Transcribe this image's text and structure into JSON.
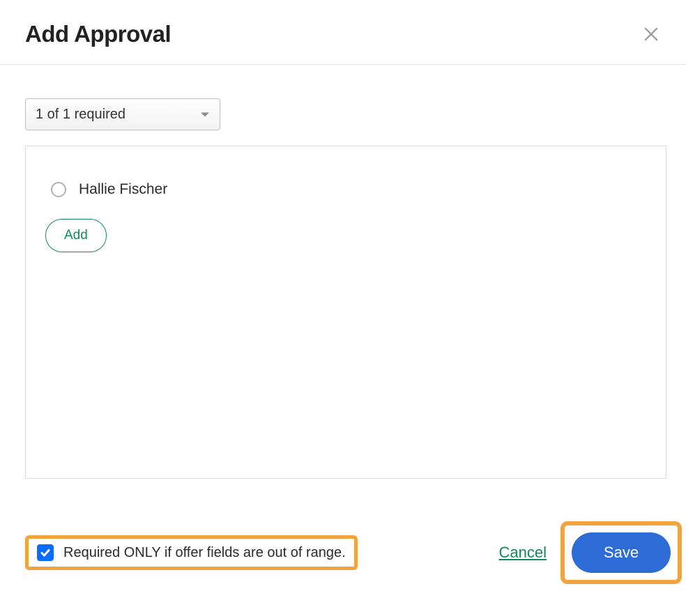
{
  "modal": {
    "title": "Add Approval"
  },
  "select": {
    "value": "1 of 1 required"
  },
  "panel": {
    "person_name": "Hallie Fischer",
    "add_label": "Add"
  },
  "footer": {
    "checkbox_label": "Required ONLY if offer fields are out of range.",
    "cancel_label": "Cancel",
    "save_label": "Save"
  }
}
